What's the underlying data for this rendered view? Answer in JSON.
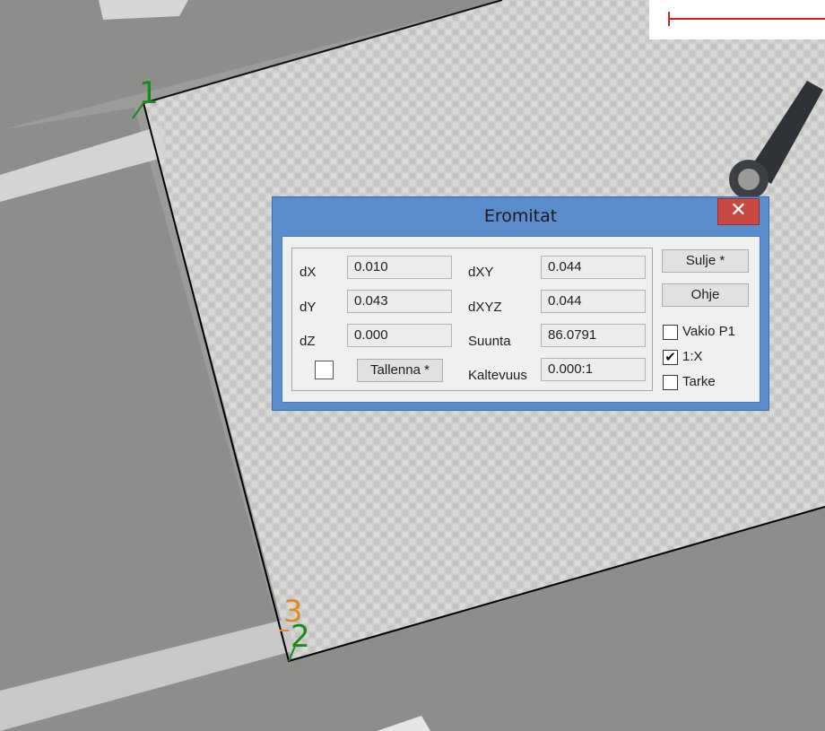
{
  "dialog": {
    "title": "Eromitat",
    "close_glyph": "✕",
    "fields": {
      "dx": {
        "label": "dX",
        "value": "0.010"
      },
      "dy": {
        "label": "dY",
        "value": "0.043"
      },
      "dz": {
        "label": "dZ",
        "value": "0.000"
      },
      "dxy": {
        "label": "dXY",
        "value": "0.044"
      },
      "dxyz": {
        "label": "dXYZ",
        "value": "0.044"
      },
      "suunta": {
        "label": "Suunta",
        "value": "86.0791"
      },
      "kaltevuus": {
        "label": "Kaltevuus",
        "value": "0.000:1"
      }
    },
    "save_label": "Tallenna *",
    "buttons": {
      "close": "Sulje *",
      "help": "Ohje"
    },
    "options": [
      {
        "label": "Vakio P1",
        "checked": false
      },
      {
        "label": "1:X",
        "checked": true
      },
      {
        "label": "Tarke",
        "checked": false
      }
    ],
    "check_glyph": "✔"
  },
  "map": {
    "points": [
      {
        "label": "1",
        "color": "#1a8a1a"
      },
      {
        "label": "2",
        "color": "#1a8a1a"
      },
      {
        "label": "3",
        "color": "#e08a1a"
      }
    ],
    "scale_bar_color": "#cc2222"
  }
}
